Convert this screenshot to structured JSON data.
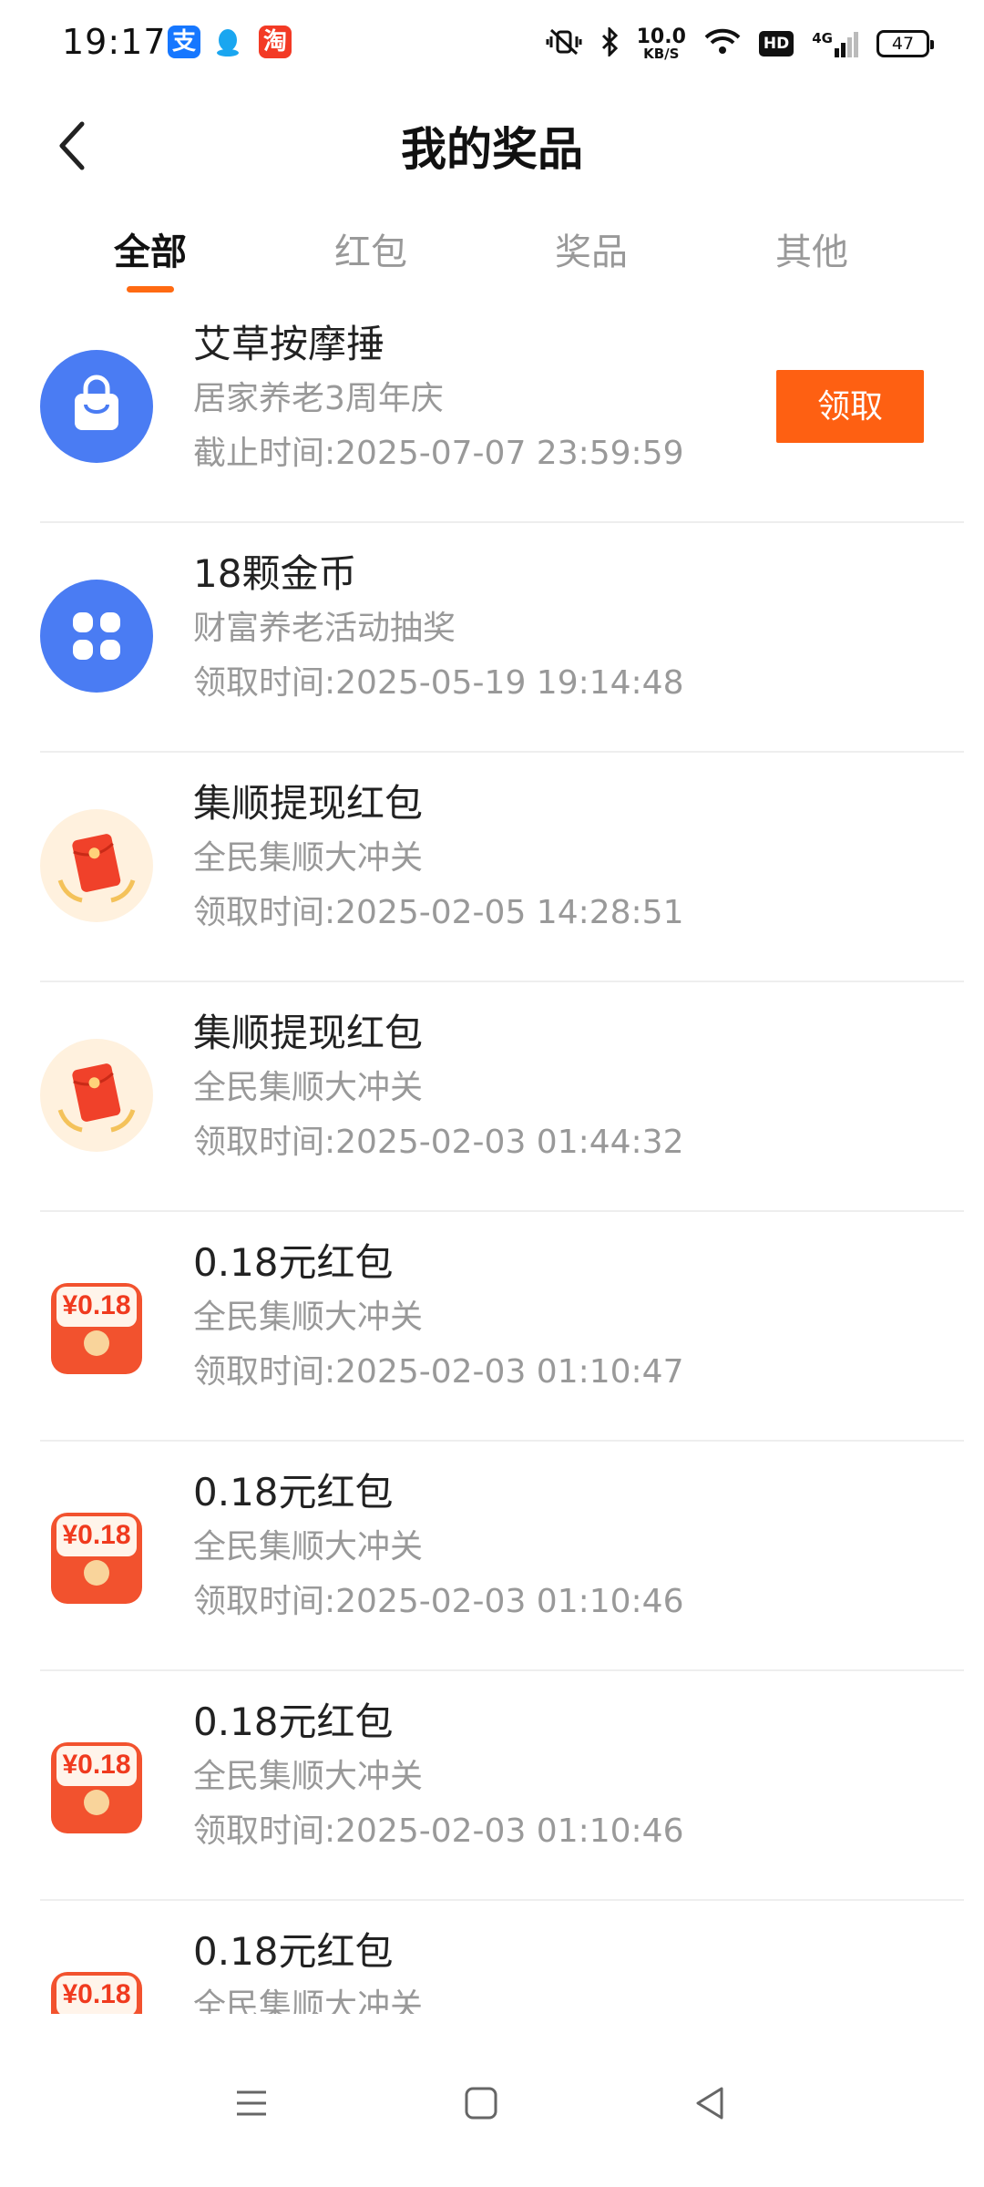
{
  "status_bar": {
    "time": "19:17",
    "apps": [
      "alipay-icon",
      "qq-icon",
      "taobao-icon"
    ],
    "net_speed_value": "10.0",
    "net_speed_unit": "KB/S",
    "hd": "HD",
    "signal": "4G",
    "battery": "47"
  },
  "header": {
    "title": "我的奖品"
  },
  "tabs": [
    {
      "label": "全部",
      "active": true
    },
    {
      "label": "红包",
      "active": false
    },
    {
      "label": "奖品",
      "active": false
    },
    {
      "label": "其他",
      "active": false
    }
  ],
  "prizes": [
    {
      "icon": "bag-icon",
      "title": "艾草按摩捶",
      "source": "居家养老3周年庆",
      "time": "截止时间:2025-07-07 23:59:59",
      "action": "领取"
    },
    {
      "icon": "grid-icon",
      "title": "18颗金币",
      "source": "财富养老活动抽奖",
      "time": "领取时间:2025-05-19 19:14:48"
    },
    {
      "icon": "red-envelope-icon",
      "title": "集顺提现红包",
      "source": "全民集顺大冲关",
      "time": "领取时间:2025-02-05 14:28:51"
    },
    {
      "icon": "red-envelope-icon",
      "title": "集顺提现红包",
      "source": "全民集顺大冲关",
      "time": "领取时间:2025-02-03 01:44:32"
    },
    {
      "icon": "red-packet-018-icon",
      "title": "0.18元红包",
      "source": "全民集顺大冲关",
      "time": "领取时间:2025-02-03 01:10:47",
      "badge": "¥0.18"
    },
    {
      "icon": "red-packet-018-icon",
      "title": "0.18元红包",
      "source": "全民集顺大冲关",
      "time": "领取时间:2025-02-03 01:10:46",
      "badge": "¥0.18"
    },
    {
      "icon": "red-packet-018-icon",
      "title": "0.18元红包",
      "source": "全民集顺大冲关",
      "time": "领取时间:2025-02-03 01:10:46",
      "badge": "¥0.18"
    },
    {
      "icon": "red-packet-018-icon",
      "title": "0.18元红包",
      "source": "全民集顺大冲关",
      "time": "",
      "badge": "¥0.18"
    }
  ],
  "colors": {
    "accent": "#fe6012",
    "blue_icon": "#4a7cf3",
    "muted_text": "#999999"
  },
  "nav_bar": [
    "menu-icon",
    "home-icon",
    "back-icon"
  ]
}
